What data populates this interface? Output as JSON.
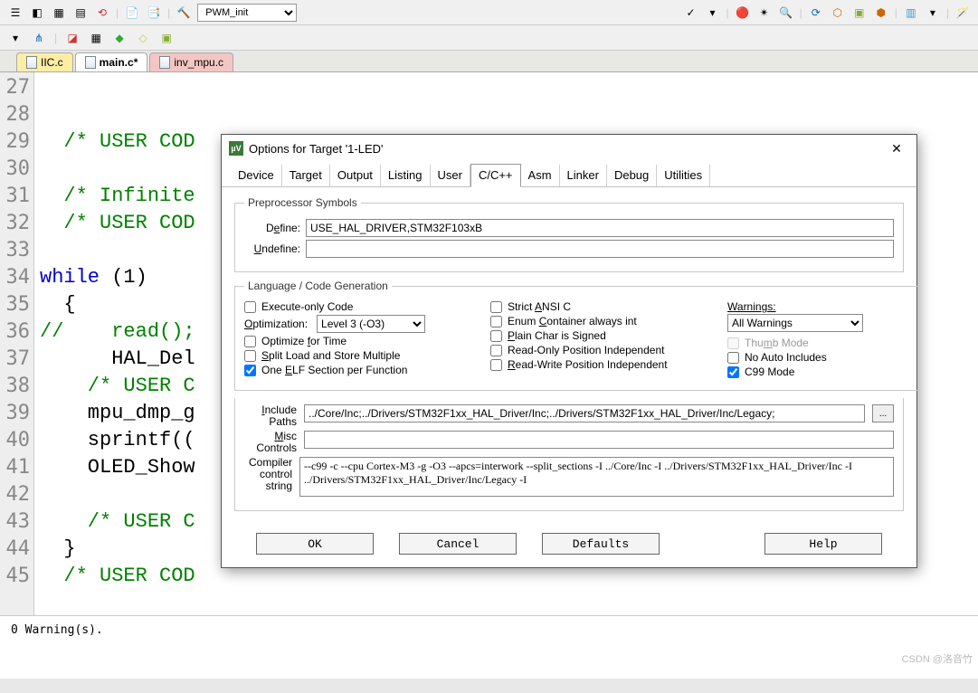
{
  "toolbar": {
    "target_select": "PWM_init"
  },
  "file_tabs": [
    "IIC.c",
    "main.c*",
    "inv_mpu.c"
  ],
  "code": {
    "line_start": 27,
    "lines": [
      "",
      "",
      "  /* USER COD",
      "",
      "  /* Infinite",
      "  /* USER COD",
      "",
      "while (1)",
      "  {",
      "//    read();",
      "      HAL_Del",
      "    /* USER C",
      "    mpu_dmp_g",
      "    sprintf((",
      "    OLED_Show",
      "",
      "    /* USER C",
      "  }",
      "  /* USER COD"
    ]
  },
  "status": {
    "text": "0 Warning(s)."
  },
  "dialog": {
    "title": "Options for Target '1-LED'",
    "tabs": [
      "Device",
      "Target",
      "Output",
      "Listing",
      "User",
      "C/C++",
      "Asm",
      "Linker",
      "Debug",
      "Utilities"
    ],
    "active_tab": "C/C++",
    "preproc": {
      "legend": "Preprocessor Symbols",
      "define_label": "Define:",
      "define_value": "USE_HAL_DRIVER,STM32F103xB",
      "undefine_label": "Undefine:",
      "undefine_value": ""
    },
    "lang": {
      "legend": "Language / Code Generation",
      "exec_only": "Execute-only Code",
      "optimization_label": "Optimization:",
      "optimization_value": "Level 3 (-O3)",
      "opt_time": "Optimize for Time",
      "split_load": "Split Load and Store Multiple",
      "one_elf": "One ELF Section per Function",
      "strict_ansi": "Strict ANSI C",
      "enum_cont": "Enum Container always int",
      "plain_char": "Plain Char is Signed",
      "ro_pi": "Read-Only Position Independent",
      "rw_pi": "Read-Write Position Independent",
      "warnings_label": "Warnings:",
      "warnings_value": "All Warnings",
      "thumb": "Thumb Mode",
      "no_auto": "No Auto Includes",
      "c99": "C99 Mode"
    },
    "include_paths_label": "Include\nPaths",
    "include_paths": "../Core/Inc;../Drivers/STM32F1xx_HAL_Driver/Inc;../Drivers/STM32F1xx_HAL_Driver/Inc/Legacy;",
    "misc_label": "Misc\nControls",
    "misc_value": "",
    "compiler_label": "Compiler\ncontrol\nstring",
    "compiler_string": "--c99 -c --cpu Cortex-M3 -g -O3 --apcs=interwork --split_sections -I ../Core/Inc -I ../Drivers/STM32F1xx_HAL_Driver/Inc -I ../Drivers/STM32F1xx_HAL_Driver/Inc/Legacy -I",
    "buttons": {
      "ok": "OK",
      "cancel": "Cancel",
      "defaults": "Defaults",
      "help": "Help"
    }
  },
  "watermark": "CSDN @洛音竹"
}
